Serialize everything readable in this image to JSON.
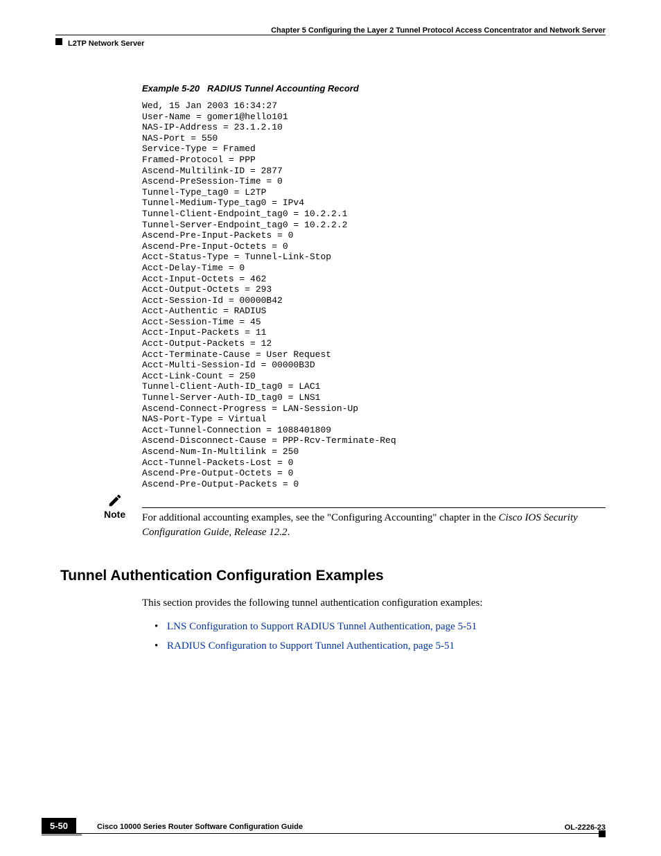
{
  "header": {
    "chapter": "Chapter 5      Configuring the Layer 2 Tunnel Protocol Access Concentrator and Network Server",
    "section": "L2TP Network Server"
  },
  "example": {
    "label": "Example 5-20",
    "title": "RADIUS Tunnel Accounting Record"
  },
  "code": "Wed, 15 Jan 2003 16:34:27\nUser-Name = gomer1@hello101\nNAS-IP-Address = 23.1.2.10\nNAS-Port = 550\nService-Type = Framed\nFramed-Protocol = PPP\nAscend-Multilink-ID = 2877\nAscend-PreSession-Time = 0\nTunnel-Type_tag0 = L2TP\nTunnel-Medium-Type_tag0 = IPv4\nTunnel-Client-Endpoint_tag0 = 10.2.2.1\nTunnel-Server-Endpoint_tag0 = 10.2.2.2\nAscend-Pre-Input-Packets = 0\nAscend-Pre-Input-Octets = 0\nAcct-Status-Type = Tunnel-Link-Stop\nAcct-Delay-Time = 0\nAcct-Input-Octets = 462\nAcct-Output-Octets = 293\nAcct-Session-Id = 00000B42\nAcct-Authentic = RADIUS\nAcct-Session-Time = 45\nAcct-Input-Packets = 11\nAcct-Output-Packets = 12\nAcct-Terminate-Cause = User Request\nAcct-Multi-Session-Id = 00000B3D\nAcct-Link-Count = 250\nTunnel-Client-Auth-ID_tag0 = LAC1\nTunnel-Server-Auth-ID_tag0 = LNS1\nAscend-Connect-Progress = LAN-Session-Up\nNAS-Port-Type = Virtual\nAcct-Tunnel-Connection = 1088401809\nAscend-Disconnect-Cause = PPP-Rcv-Terminate-Req\nAscend-Num-In-Multilink = 250\nAcct-Tunnel-Packets-Lost = 0\nAscend-Pre-Output-Octets = 0\nAscend-Pre-Output-Packets = 0",
  "note": {
    "label": "Note",
    "text1": "For additional accounting examples, see the \"Configuring Accounting\" chapter in the ",
    "text2_italic": "Cisco IOS Security Configuration Guide, Release 12.2",
    "text3": "."
  },
  "section2": {
    "heading": "Tunnel Authentication Configuration Examples",
    "intro": "This section provides the following tunnel authentication configuration examples:",
    "items": [
      "LNS Configuration to Support RADIUS Tunnel Authentication, page 5-51",
      "RADIUS Configuration to Support Tunnel Authentication, page 5-51"
    ]
  },
  "footer": {
    "title": "Cisco 10000 Series Router Software Configuration Guide",
    "page": "5-50",
    "doc": "OL-2226-23"
  }
}
